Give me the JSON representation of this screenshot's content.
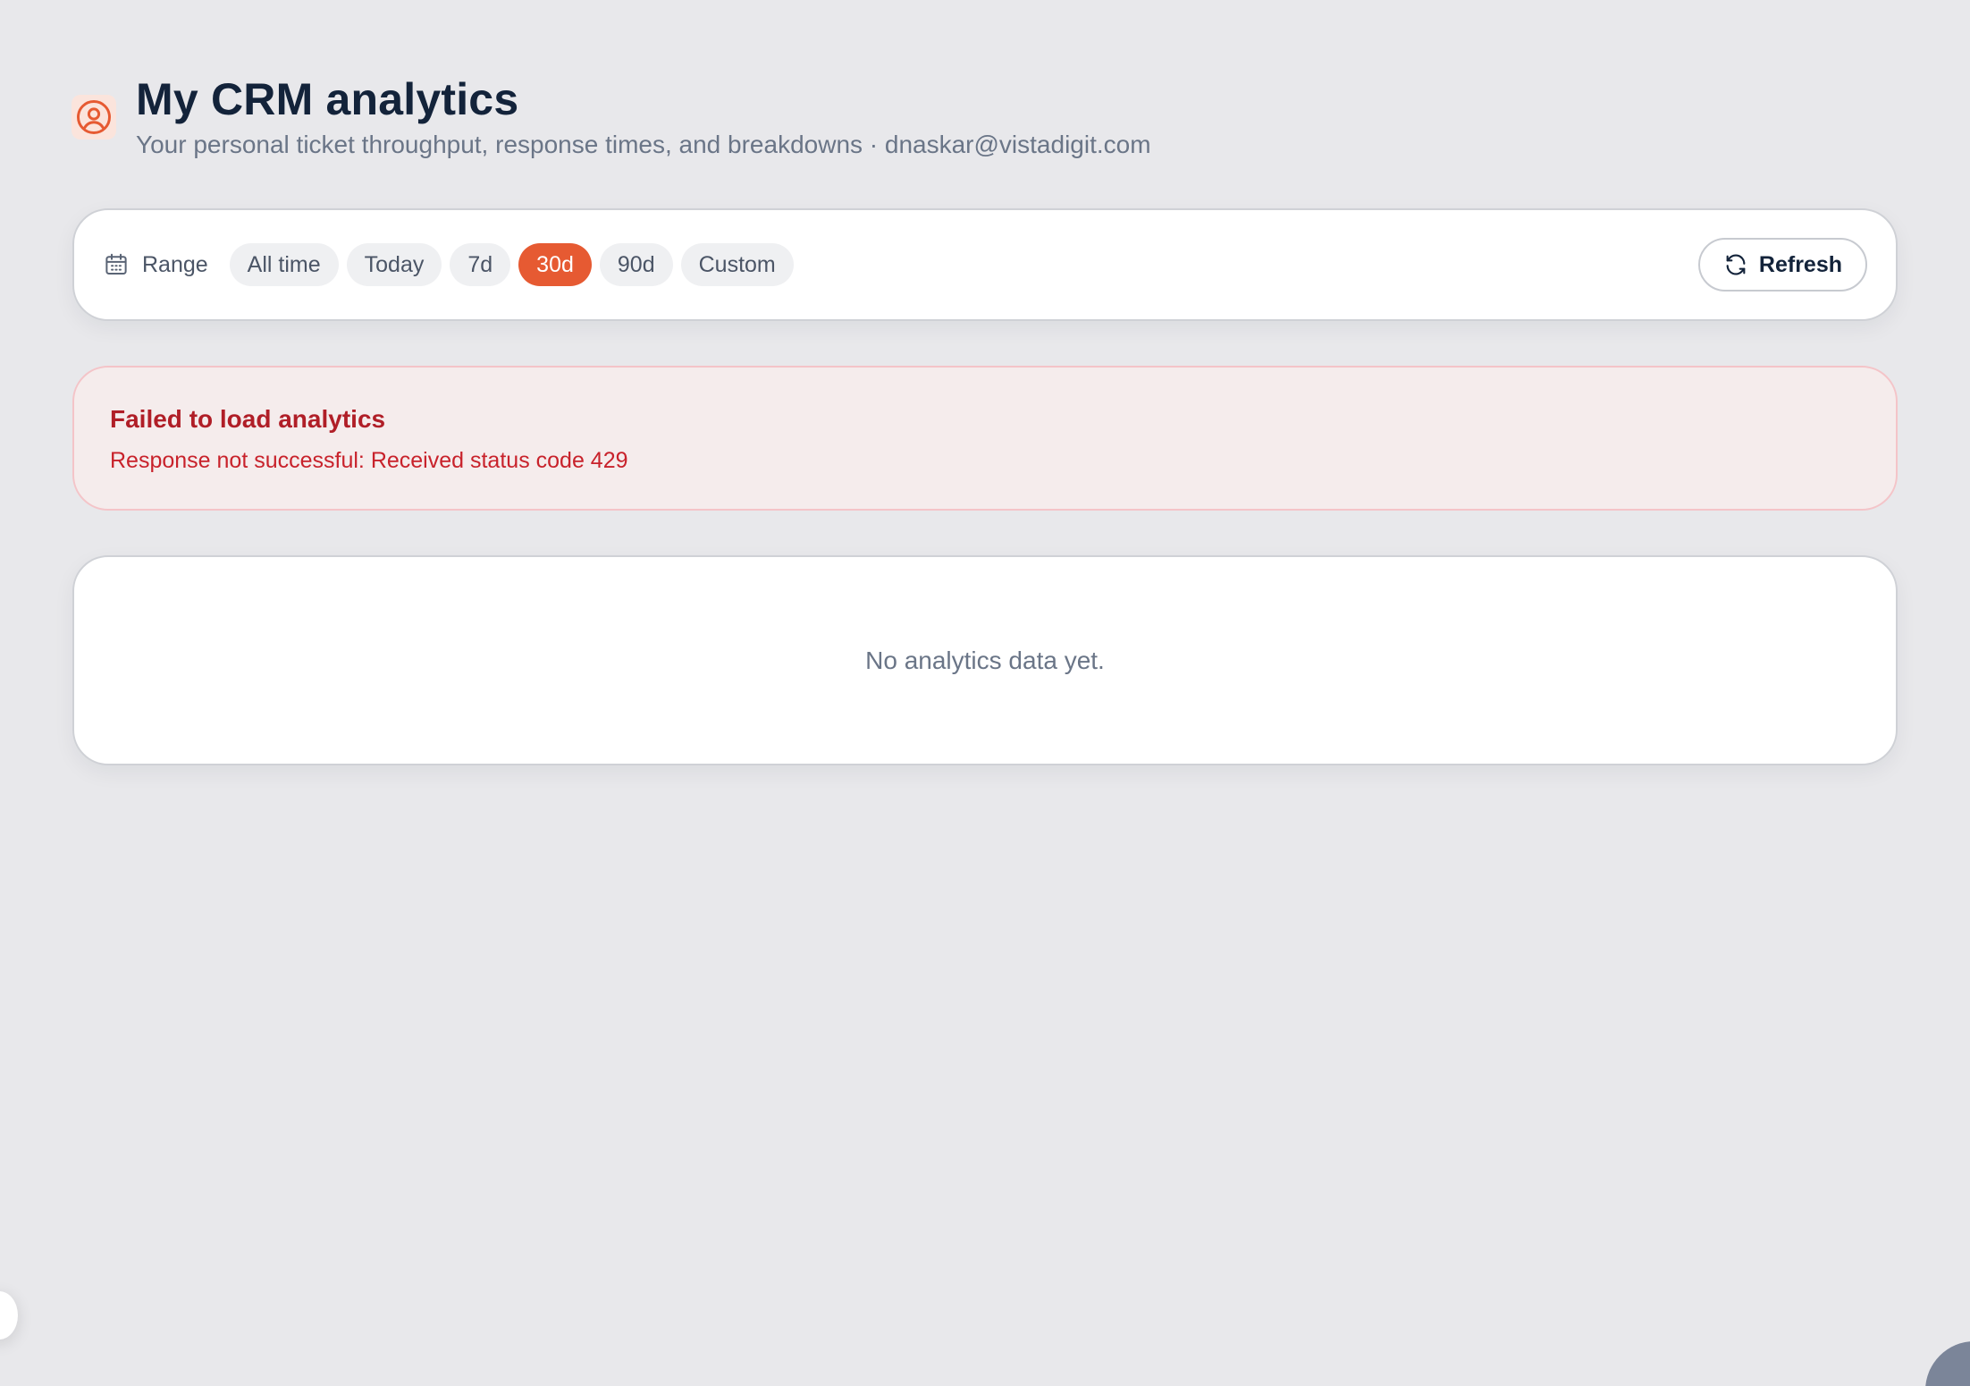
{
  "header": {
    "title": "My CRM analytics",
    "subtitle": "Your personal ticket throughput, response times, and breakdowns · dnaskar@vistadigit.com",
    "icon": "user-circle-icon"
  },
  "toolbar": {
    "range_label": "Range",
    "range_icon": "calendar-icon",
    "ranges": [
      "All time",
      "Today",
      "7d",
      "30d",
      "90d",
      "Custom"
    ],
    "selected_range": "30d",
    "refresh_label": "Refresh",
    "refresh_icon": "refresh-icon"
  },
  "error": {
    "title": "Failed to load analytics",
    "message": "Response not successful: Received status code 429"
  },
  "empty_state": {
    "message": "No analytics data yet."
  },
  "colors": {
    "accent": "#e65a32",
    "error_text": "#b01e27",
    "error_bg": "#f5ecec",
    "background": "#e8e8eb"
  }
}
